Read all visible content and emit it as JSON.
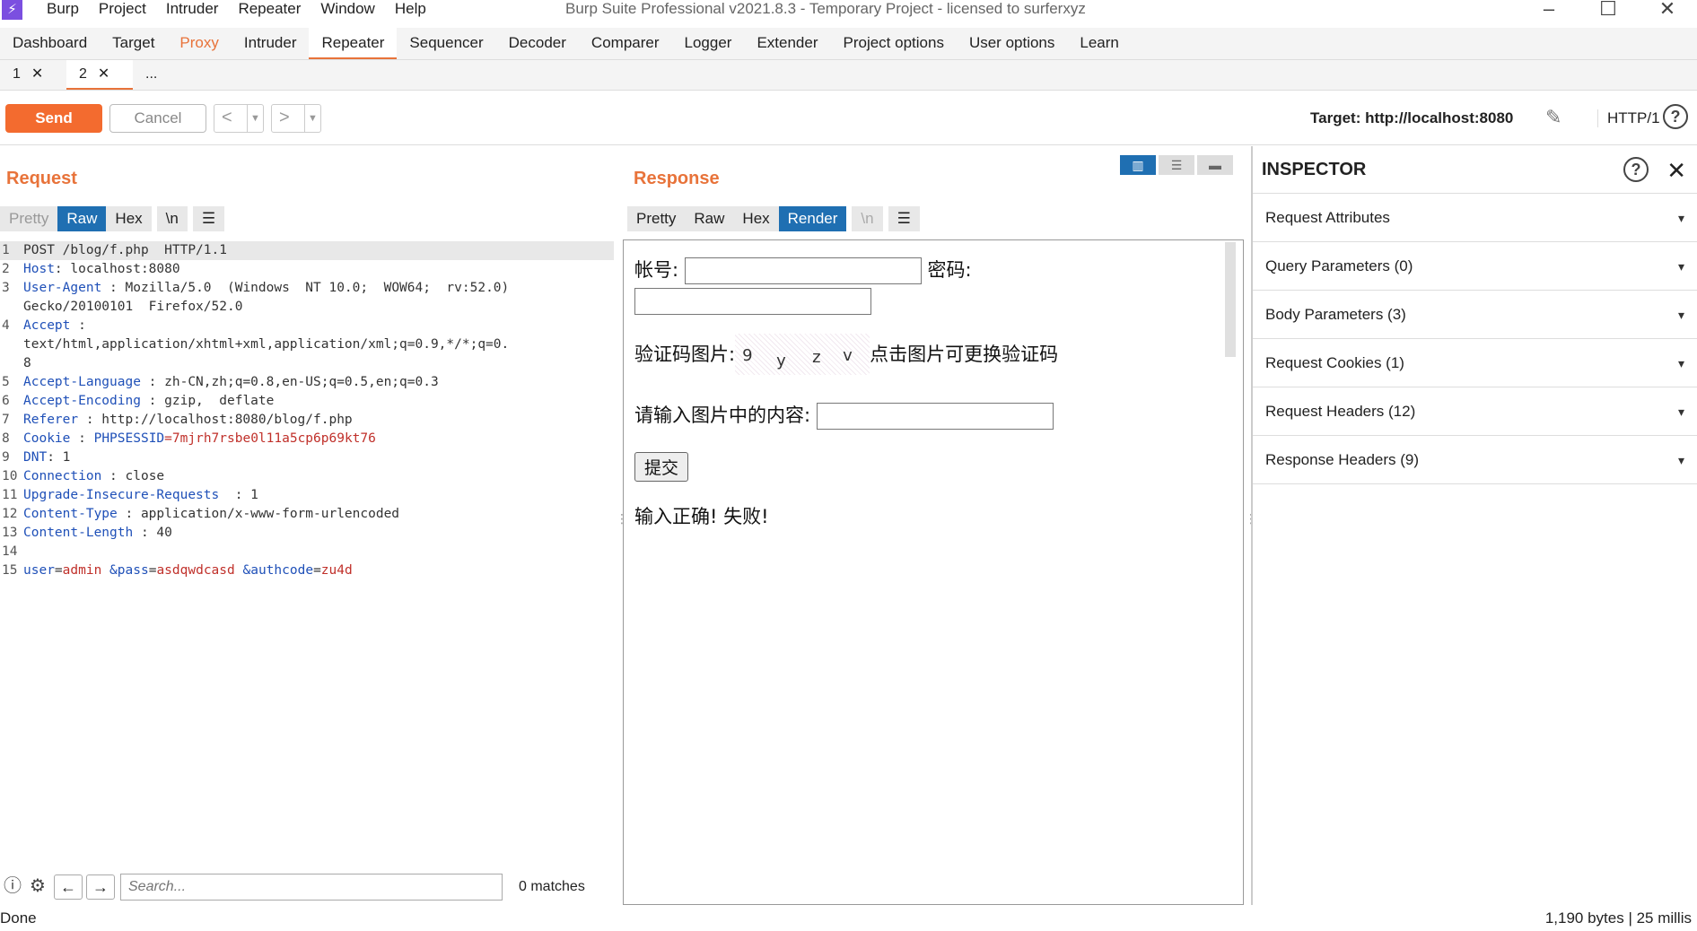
{
  "app": {
    "title": "Burp Suite Professional v2021.8.3 - Temporary Project - licensed to surferxyz",
    "menu": [
      "Burp",
      "Project",
      "Intruder",
      "Repeater",
      "Window",
      "Help"
    ],
    "logo_glyph": "⚡"
  },
  "main_tabs": [
    "Dashboard",
    "Target",
    "Proxy",
    "Intruder",
    "Repeater",
    "Sequencer",
    "Decoder",
    "Comparer",
    "Logger",
    "Extender",
    "Project options",
    "User options",
    "Learn"
  ],
  "sub_tabs": [
    "1",
    "2",
    "..."
  ],
  "toolbar": {
    "send_label": "Send",
    "cancel_label": "Cancel",
    "target": "Target: http://localhost:8080",
    "http_version": "HTTP/1"
  },
  "request": {
    "title": "Request",
    "formats": [
      "Pretty",
      "Raw",
      "Hex",
      "\\n"
    ],
    "lines": [
      {
        "n": "1",
        "name": "",
        "value": "POST /blog/f.php  HTTP/1.1"
      },
      {
        "n": "2",
        "name": "Host",
        "value": ": localhost:8080"
      },
      {
        "n": "3",
        "name": "User-Agent",
        "value": " : Mozilla/5.0  (Windows  NT 10.0;  WOW64;  rv:52.0)"
      },
      {
        "n": "",
        "name": "",
        "value": "Gecko/20100101  Firefox/52.0"
      },
      {
        "n": "4",
        "name": "Accept",
        "value": " :"
      },
      {
        "n": "",
        "name": "",
        "value": "text/html,application/xhtml+xml,application/xml;q=0.9,*/*;q=0."
      },
      {
        "n": "",
        "name": "",
        "value": "8"
      },
      {
        "n": "5",
        "name": "Accept-Language",
        "value": " : zh-CN,zh;q=0.8,en-US;q=0.5,en;q=0.3"
      },
      {
        "n": "6",
        "name": "Accept-Encoding",
        "value": " : gzip,  deflate"
      },
      {
        "n": "7",
        "name": "Referer",
        "value": " : http://localhost:8080/blog/f.php"
      },
      {
        "n": "8",
        "name": "Cookie",
        "value": " : ",
        "cookie_name": "PHPSESSID",
        "cookie_value": "=7mjrh7rsbe0l11a5cp6p69kt76"
      },
      {
        "n": "9",
        "name": "DNT",
        "value": ": 1"
      },
      {
        "n": "10",
        "name": "Connection",
        "value": " : close"
      },
      {
        "n": "11",
        "name": "Upgrade-Insecure-Requests",
        "value": "  : 1"
      },
      {
        "n": "12",
        "name": "Content-Type",
        "value": " : application/x-www-form-urlencoded"
      },
      {
        "n": "13",
        "name": "Content-Length",
        "value": " : 40"
      },
      {
        "n": "14",
        "name": "",
        "value": ""
      },
      {
        "n": "15",
        "body": true
      }
    ],
    "body_params": [
      {
        "k": "user",
        "v": "admin"
      },
      {
        "k": "pass",
        "v": "asdqwdcasd"
      },
      {
        "k": "authcode",
        "v": "zu4d"
      }
    ],
    "search_placeholder": "Search...",
    "matches": "0 matches"
  },
  "response": {
    "title": "Response",
    "formats": [
      "Pretty",
      "Raw",
      "Hex",
      "Render",
      "\\n"
    ],
    "render": {
      "account_label": "帐号:",
      "password_label": "密码:",
      "captcha_label": "验证码图片:",
      "captcha_chars": [
        "9",
        "y",
        "z",
        "v"
      ],
      "captcha_hint": "点击图片可更换验证码",
      "enter_label": "请输入图片中的内容:",
      "submit_label": "提交",
      "result": "输入正确! 失败!"
    }
  },
  "inspector": {
    "title": "INSPECTOR",
    "items": [
      "Request Attributes",
      "Query Parameters (0)",
      "Body Parameters (3)",
      "Request Cookies (1)",
      "Request Headers (12)",
      "Response Headers (9)"
    ]
  },
  "status": {
    "left": "Done",
    "right": "1,190 bytes | 25 millis"
  },
  "colors": {
    "accent": "#e8733a",
    "selected": "#1f6fb2"
  }
}
